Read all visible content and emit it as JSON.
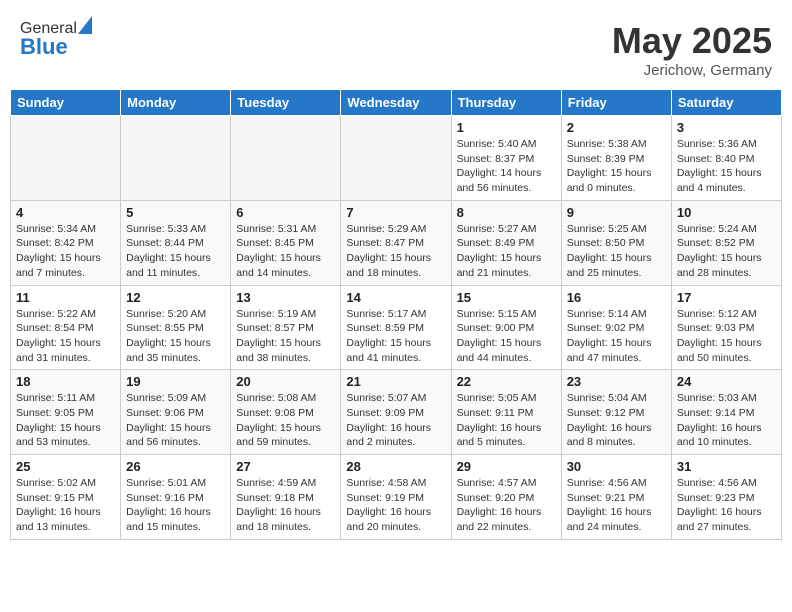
{
  "header": {
    "logo_line1": "General",
    "logo_line2": "Blue",
    "month_title": "May 2025",
    "location": "Jerichow, Germany"
  },
  "weekdays": [
    "Sunday",
    "Monday",
    "Tuesday",
    "Wednesday",
    "Thursday",
    "Friday",
    "Saturday"
  ],
  "weeks": [
    [
      {
        "day": "",
        "info": ""
      },
      {
        "day": "",
        "info": ""
      },
      {
        "day": "",
        "info": ""
      },
      {
        "day": "",
        "info": ""
      },
      {
        "day": "1",
        "info": "Sunrise: 5:40 AM\nSunset: 8:37 PM\nDaylight: 14 hours\nand 56 minutes."
      },
      {
        "day": "2",
        "info": "Sunrise: 5:38 AM\nSunset: 8:39 PM\nDaylight: 15 hours\nand 0 minutes."
      },
      {
        "day": "3",
        "info": "Sunrise: 5:36 AM\nSunset: 8:40 PM\nDaylight: 15 hours\nand 4 minutes."
      }
    ],
    [
      {
        "day": "4",
        "info": "Sunrise: 5:34 AM\nSunset: 8:42 PM\nDaylight: 15 hours\nand 7 minutes."
      },
      {
        "day": "5",
        "info": "Sunrise: 5:33 AM\nSunset: 8:44 PM\nDaylight: 15 hours\nand 11 minutes."
      },
      {
        "day": "6",
        "info": "Sunrise: 5:31 AM\nSunset: 8:45 PM\nDaylight: 15 hours\nand 14 minutes."
      },
      {
        "day": "7",
        "info": "Sunrise: 5:29 AM\nSunset: 8:47 PM\nDaylight: 15 hours\nand 18 minutes."
      },
      {
        "day": "8",
        "info": "Sunrise: 5:27 AM\nSunset: 8:49 PM\nDaylight: 15 hours\nand 21 minutes."
      },
      {
        "day": "9",
        "info": "Sunrise: 5:25 AM\nSunset: 8:50 PM\nDaylight: 15 hours\nand 25 minutes."
      },
      {
        "day": "10",
        "info": "Sunrise: 5:24 AM\nSunset: 8:52 PM\nDaylight: 15 hours\nand 28 minutes."
      }
    ],
    [
      {
        "day": "11",
        "info": "Sunrise: 5:22 AM\nSunset: 8:54 PM\nDaylight: 15 hours\nand 31 minutes."
      },
      {
        "day": "12",
        "info": "Sunrise: 5:20 AM\nSunset: 8:55 PM\nDaylight: 15 hours\nand 35 minutes."
      },
      {
        "day": "13",
        "info": "Sunrise: 5:19 AM\nSunset: 8:57 PM\nDaylight: 15 hours\nand 38 minutes."
      },
      {
        "day": "14",
        "info": "Sunrise: 5:17 AM\nSunset: 8:59 PM\nDaylight: 15 hours\nand 41 minutes."
      },
      {
        "day": "15",
        "info": "Sunrise: 5:15 AM\nSunset: 9:00 PM\nDaylight: 15 hours\nand 44 minutes."
      },
      {
        "day": "16",
        "info": "Sunrise: 5:14 AM\nSunset: 9:02 PM\nDaylight: 15 hours\nand 47 minutes."
      },
      {
        "day": "17",
        "info": "Sunrise: 5:12 AM\nSunset: 9:03 PM\nDaylight: 15 hours\nand 50 minutes."
      }
    ],
    [
      {
        "day": "18",
        "info": "Sunrise: 5:11 AM\nSunset: 9:05 PM\nDaylight: 15 hours\nand 53 minutes."
      },
      {
        "day": "19",
        "info": "Sunrise: 5:09 AM\nSunset: 9:06 PM\nDaylight: 15 hours\nand 56 minutes."
      },
      {
        "day": "20",
        "info": "Sunrise: 5:08 AM\nSunset: 9:08 PM\nDaylight: 15 hours\nand 59 minutes."
      },
      {
        "day": "21",
        "info": "Sunrise: 5:07 AM\nSunset: 9:09 PM\nDaylight: 16 hours\nand 2 minutes."
      },
      {
        "day": "22",
        "info": "Sunrise: 5:05 AM\nSunset: 9:11 PM\nDaylight: 16 hours\nand 5 minutes."
      },
      {
        "day": "23",
        "info": "Sunrise: 5:04 AM\nSunset: 9:12 PM\nDaylight: 16 hours\nand 8 minutes."
      },
      {
        "day": "24",
        "info": "Sunrise: 5:03 AM\nSunset: 9:14 PM\nDaylight: 16 hours\nand 10 minutes."
      }
    ],
    [
      {
        "day": "25",
        "info": "Sunrise: 5:02 AM\nSunset: 9:15 PM\nDaylight: 16 hours\nand 13 minutes."
      },
      {
        "day": "26",
        "info": "Sunrise: 5:01 AM\nSunset: 9:16 PM\nDaylight: 16 hours\nand 15 minutes."
      },
      {
        "day": "27",
        "info": "Sunrise: 4:59 AM\nSunset: 9:18 PM\nDaylight: 16 hours\nand 18 minutes."
      },
      {
        "day": "28",
        "info": "Sunrise: 4:58 AM\nSunset: 9:19 PM\nDaylight: 16 hours\nand 20 minutes."
      },
      {
        "day": "29",
        "info": "Sunrise: 4:57 AM\nSunset: 9:20 PM\nDaylight: 16 hours\nand 22 minutes."
      },
      {
        "day": "30",
        "info": "Sunrise: 4:56 AM\nSunset: 9:21 PM\nDaylight: 16 hours\nand 24 minutes."
      },
      {
        "day": "31",
        "info": "Sunrise: 4:56 AM\nSunset: 9:23 PM\nDaylight: 16 hours\nand 27 minutes."
      }
    ]
  ]
}
